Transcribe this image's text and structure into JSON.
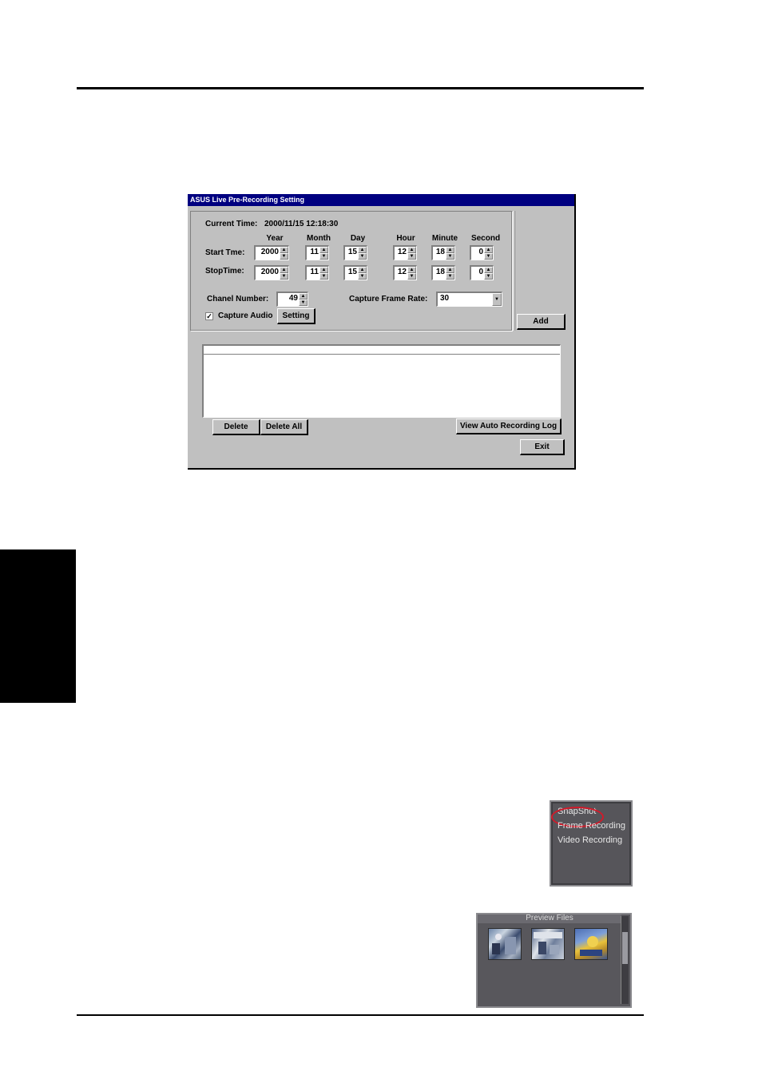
{
  "dialog": {
    "title": "ASUS Live Pre-Recording Setting",
    "current_time_label": "Current Time:",
    "current_time_value": "2000/11/15 12:18:30",
    "column_headers": [
      "Year",
      "Month",
      "Day",
      "Hour",
      "Minute",
      "Second"
    ],
    "start_label": "Start Tme:",
    "stop_label": "StopTime:",
    "start_values": [
      "2000",
      "11",
      "15",
      "12",
      "18",
      "0"
    ],
    "stop_values": [
      "2000",
      "11",
      "15",
      "12",
      "18",
      "0"
    ],
    "channel_label": "Chanel Number:",
    "channel_value": "49",
    "frame_rate_label": "Capture Frame Rate:",
    "frame_rate_value": "30",
    "capture_audio_label": "Capture Audio",
    "capture_audio_checked": true,
    "setting_button": "Setting",
    "add_button": "Add",
    "delete_button": "Delete",
    "delete_all_button": "Delete All",
    "view_log_button": "View Auto Recording Log",
    "exit_button": "Exit"
  },
  "menu": {
    "items": [
      "SnapShot",
      "Frame Recording",
      "Video Recording"
    ],
    "highlighted": "SnapShot"
  },
  "preview": {
    "title": "Preview Files",
    "thumbnail_count": 3
  }
}
